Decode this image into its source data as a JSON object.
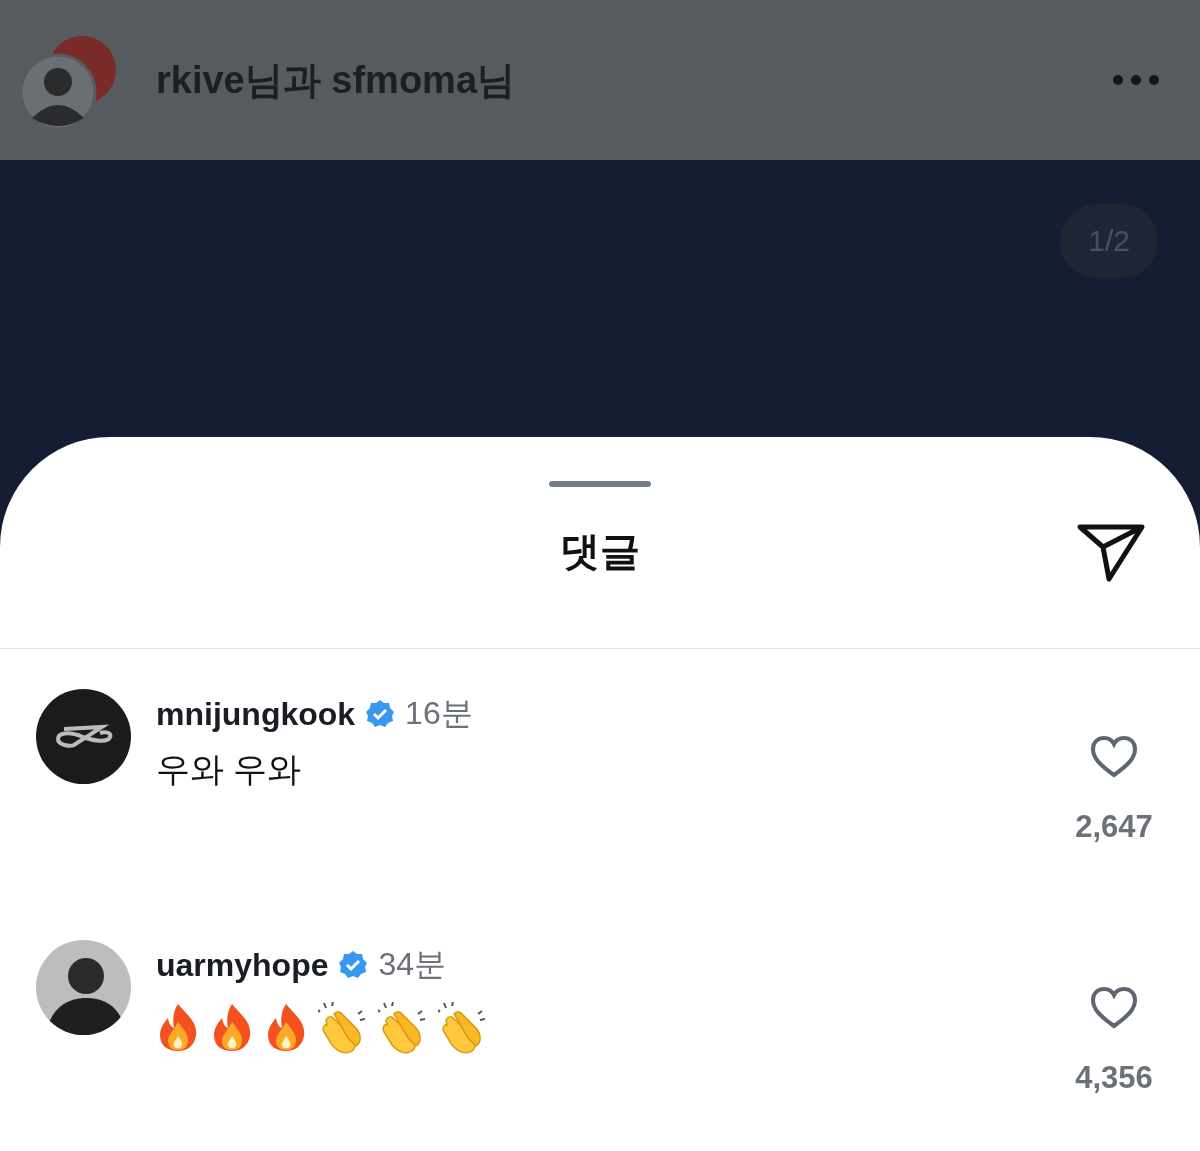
{
  "header": {
    "title": "rkive님과 sfmoma님"
  },
  "post": {
    "page_indicator": "1/2"
  },
  "sheet": {
    "title": "댓글"
  },
  "comments": [
    {
      "username": "mnijungkook",
      "verified": true,
      "time": "16분",
      "avatar": {
        "kind": "logo"
      },
      "text": "우와 우와",
      "likes": "2,647",
      "liked": false
    },
    {
      "username": "uarmyhope",
      "verified": true,
      "time": "34분",
      "avatar": {
        "kind": "photo"
      },
      "emojis": [
        {
          "kind": "fire"
        },
        {
          "kind": "fire"
        },
        {
          "kind": "fire"
        },
        {
          "kind": "clap"
        },
        {
          "kind": "clap"
        },
        {
          "kind": "clap"
        }
      ],
      "likes": "4,356",
      "liked": false
    }
  ]
}
